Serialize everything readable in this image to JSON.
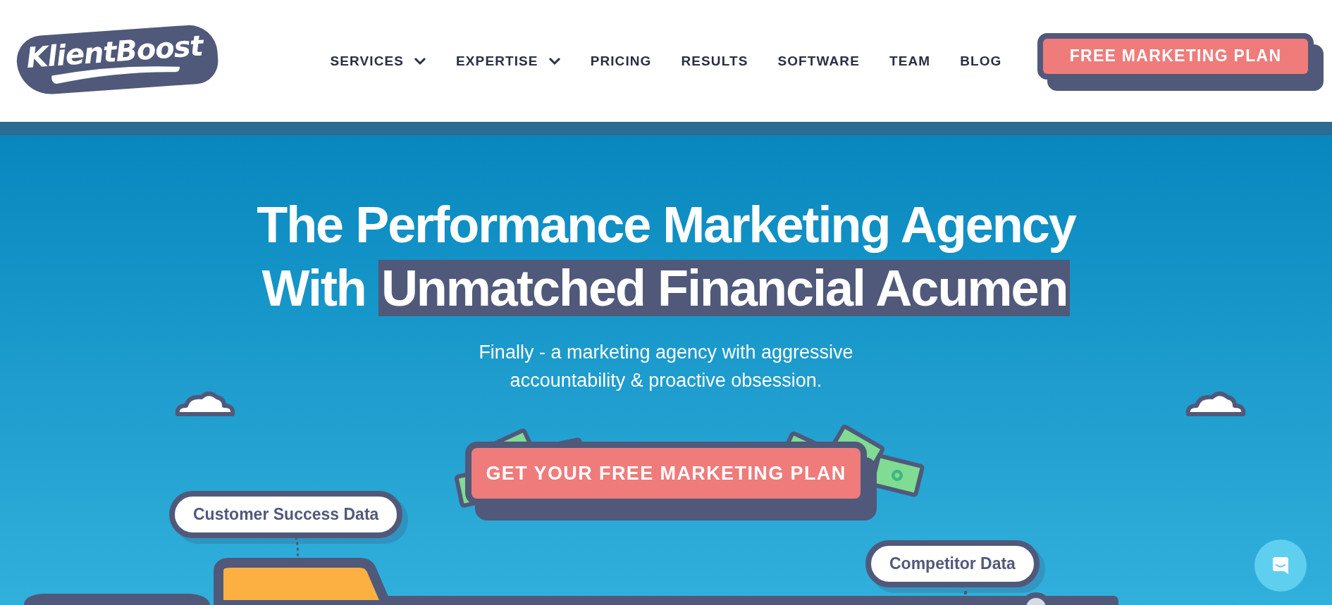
{
  "header": {
    "logo": "KlientBoost",
    "nav": [
      {
        "label": "SERVICES",
        "has_dropdown": true
      },
      {
        "label": "EXPERTISE",
        "has_dropdown": true
      },
      {
        "label": "PRICING",
        "has_dropdown": false
      },
      {
        "label": "RESULTS",
        "has_dropdown": false
      },
      {
        "label": "SOFTWARE",
        "has_dropdown": false
      },
      {
        "label": "TEAM",
        "has_dropdown": false
      },
      {
        "label": "BLOG",
        "has_dropdown": false
      }
    ],
    "cta": "FREE MARKETING PLAN"
  },
  "hero": {
    "title_line_1": "The Performance Marketing Agency",
    "title_lead": "With",
    "title_highlight": "Unmatched Financial Acumen",
    "subtitle_line_1": "Finally - a marketing agency with aggressive",
    "subtitle_line_2": "accountability & proactive obsession.",
    "cta": "GET YOUR FREE MARKETING PLAN"
  },
  "illustration": {
    "labels": [
      "Customer Success Data",
      "Competitor Data"
    ]
  }
}
